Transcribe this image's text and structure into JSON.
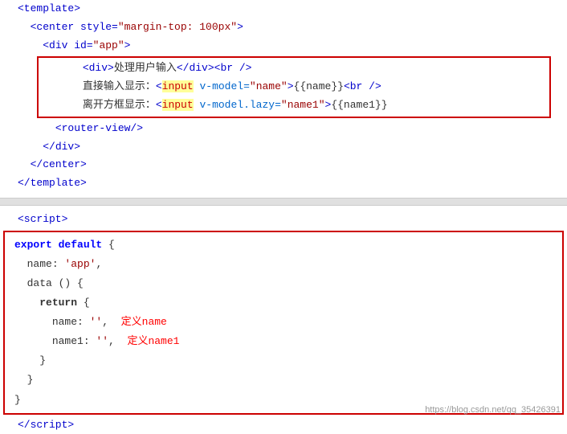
{
  "template_section": {
    "lines": [
      {
        "num": "",
        "content": "template_open"
      },
      {
        "num": "",
        "content": "center_open"
      },
      {
        "num": "",
        "content": "div_open"
      },
      {
        "num": "",
        "content": "div_process"
      },
      {
        "num": "",
        "content": "input_direct"
      },
      {
        "num": "",
        "content": "input_lazy"
      },
      {
        "num": "",
        "content": "router_view"
      },
      {
        "num": "",
        "content": "div_close"
      },
      {
        "num": "",
        "content": "center_close"
      },
      {
        "num": "",
        "content": "template_close"
      }
    ]
  },
  "script_section": {
    "lines": [
      {
        "content": "script_open"
      },
      {
        "content": "export_default"
      },
      {
        "content": "name_app"
      },
      {
        "content": "data_func"
      },
      {
        "content": "return_open"
      },
      {
        "content": "name_val"
      },
      {
        "content": "name1_val"
      },
      {
        "content": "return_close"
      },
      {
        "content": "func_close"
      },
      {
        "content": "export_close"
      },
      {
        "content": "script_close"
      }
    ]
  },
  "watermark": "https://blog.csdn.net/qq_35426391"
}
